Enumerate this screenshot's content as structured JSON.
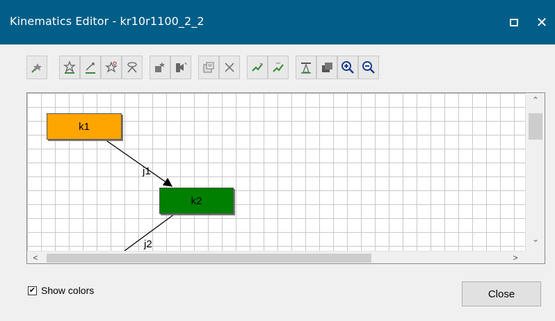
{
  "window": {
    "title": "Kinematics Editor -  kr10r1100_2_2",
    "title_bar_color": "#005e88"
  },
  "toolbar": {
    "buttons": [
      {
        "name": "add-node-icon"
      },
      {
        "name": "add-joint-icon"
      },
      {
        "name": "link-joints-icon"
      },
      {
        "name": "joint-properties-icon"
      },
      {
        "name": "joint-dependency-icon"
      },
      {
        "name": "set-base-icon"
      },
      {
        "name": "set-tool-icon"
      },
      {
        "name": "properties-icon"
      },
      {
        "name": "delete-icon"
      },
      {
        "name": "open-loop-icon"
      },
      {
        "name": "closed-loop-icon"
      },
      {
        "name": "tcp-frame-icon"
      },
      {
        "name": "layers-icon"
      },
      {
        "name": "zoom-in-icon"
      },
      {
        "name": "zoom-out-icon"
      }
    ]
  },
  "diagram": {
    "nodes": [
      {
        "label": "k1",
        "color": "#ffa500"
      },
      {
        "label": "k2",
        "color": "#008000"
      }
    ],
    "joints": [
      {
        "label": "j1"
      },
      {
        "label": "j2"
      }
    ]
  },
  "options": {
    "show_colors_label": "Show colors",
    "show_colors_checked": true,
    "check_mark": "✔"
  },
  "buttons": {
    "close_label": "Close"
  },
  "scrollbars": {
    "up": "⌃",
    "down": "⌄",
    "left": "<",
    "right": ">"
  }
}
